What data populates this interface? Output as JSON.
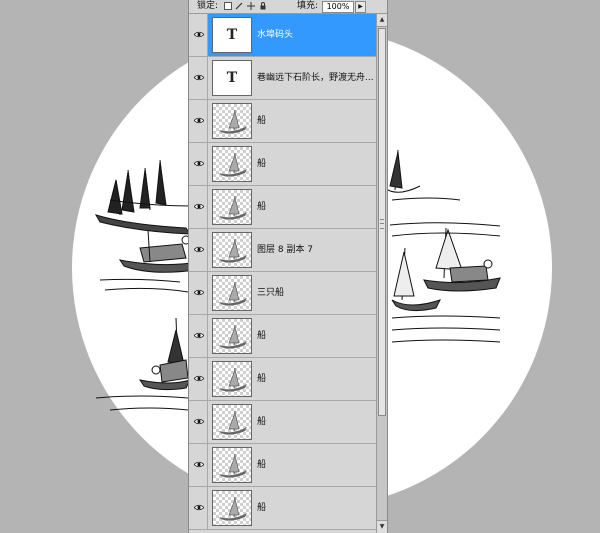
{
  "lock_bar": {
    "lock_label": "锁定:",
    "fill_label": "填充:",
    "fill_value": "100%"
  },
  "icons": {
    "lock_transparent": "lock-transparent-pixels-icon",
    "lock_image": "brush-icon",
    "lock_position": "move-icon",
    "lock_all": "lock-icon",
    "visibility": "eye-icon"
  },
  "colors": {
    "canvas_bg": "#b4b4b4",
    "panel_bg": "#d6d6d6",
    "selection": "#3399ff"
  },
  "layers": [
    {
      "name": "水埠码头",
      "kind": "text",
      "selected": true
    },
    {
      "name": "巷幽远下石阶长，野渡无舟...",
      "kind": "text",
      "selected": false
    },
    {
      "name": "船",
      "kind": "image",
      "selected": false
    },
    {
      "name": "船",
      "kind": "image",
      "selected": false
    },
    {
      "name": "船",
      "kind": "image",
      "selected": false
    },
    {
      "name": "图层 8 副本 7",
      "kind": "image",
      "selected": false
    },
    {
      "name": "三只船",
      "kind": "image",
      "selected": false
    },
    {
      "name": "船",
      "kind": "image",
      "selected": false
    },
    {
      "name": "船",
      "kind": "image",
      "selected": false
    },
    {
      "name": "船",
      "kind": "image",
      "selected": false
    },
    {
      "name": "船",
      "kind": "image",
      "selected": false
    },
    {
      "name": "船",
      "kind": "image",
      "selected": false
    }
  ],
  "text_thumb_glyph": "T"
}
